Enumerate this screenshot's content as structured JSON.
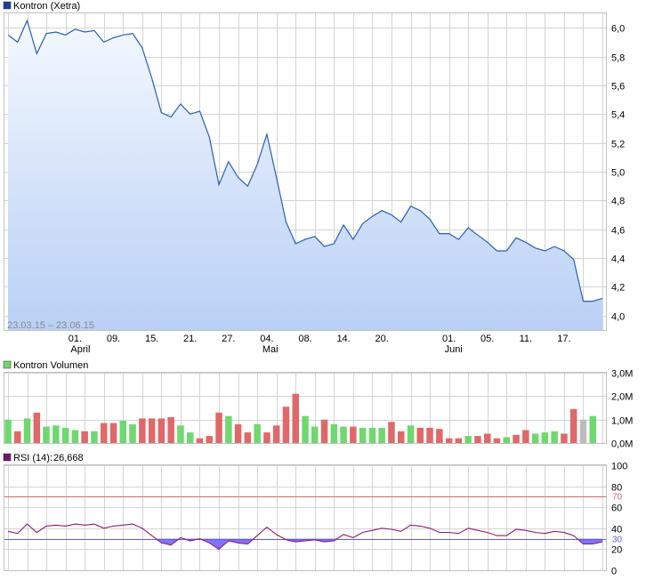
{
  "colors": {
    "price_line": "#2a5fb0",
    "price_fill_top": "#f4f8fe",
    "price_fill_bottom": "#b9d0f5",
    "vol_up": "#6fd86f",
    "vol_down": "#e06868",
    "vol_neutral": "#bdbdbd",
    "rsi_line": "#8c1a7a",
    "rsi_fill": "#6a5cf5",
    "rsi_70": "#d06a6a",
    "rsi_30": "#5a5ae0",
    "legend_price": "#1f3f9a",
    "legend_volume": "#6fd86f",
    "legend_rsi": "#6a1a6a"
  },
  "chart_data": [
    {
      "type": "area",
      "title": "Kontron (Xetra)",
      "date_range": "23.03.15 – 23.06.15",
      "ylim": [
        3.9,
        6.1
      ],
      "y_ticks": [
        "6,0",
        "5,8",
        "5,6",
        "5,4",
        "5,2",
        "5,0",
        "4,8",
        "4,6",
        "4,4",
        "4,2",
        "4,0"
      ],
      "y_tick_values": [
        6.0,
        5.8,
        5.6,
        5.4,
        5.2,
        5.0,
        4.8,
        4.6,
        4.4,
        4.2,
        4.0
      ],
      "x_ticks": [
        {
          "label": "01.",
          "sub": "April",
          "i": 7
        },
        {
          "label": "09.",
          "sub": "",
          "i": 11
        },
        {
          "label": "15.",
          "sub": "",
          "i": 15
        },
        {
          "label": "21.",
          "sub": "",
          "i": 19
        },
        {
          "label": "27.",
          "sub": "",
          "i": 23
        },
        {
          "label": "04.",
          "sub": "Mai",
          "i": 27
        },
        {
          "label": "08.",
          "sub": "",
          "i": 31
        },
        {
          "label": "14.",
          "sub": "",
          "i": 35
        },
        {
          "label": "20.",
          "sub": "",
          "i": 39
        },
        {
          "label": "01.",
          "sub": "Juni",
          "i": 46
        },
        {
          "label": "05.",
          "sub": "",
          "i": 50
        },
        {
          "label": "11.",
          "sub": "",
          "i": 54
        },
        {
          "label": "17.",
          "sub": "",
          "i": 58
        }
      ],
      "values": [
        5.95,
        5.9,
        6.05,
        5.82,
        5.96,
        5.97,
        5.95,
        5.99,
        5.97,
        5.98,
        5.9,
        5.93,
        5.95,
        5.96,
        5.86,
        5.65,
        5.41,
        5.38,
        5.47,
        5.4,
        5.42,
        5.24,
        4.91,
        5.07,
        4.96,
        4.9,
        5.05,
        5.26,
        4.96,
        4.65,
        4.5,
        4.53,
        4.55,
        4.48,
        4.5,
        4.63,
        4.53,
        4.64,
        4.69,
        4.73,
        4.7,
        4.65,
        4.76,
        4.73,
        4.67,
        4.57,
        4.57,
        4.53,
        4.61,
        4.56,
        4.51,
        4.45,
        4.45,
        4.54,
        4.51,
        4.47,
        4.45,
        4.48,
        4.45,
        4.39,
        4.1,
        4.1,
        4.12
      ]
    },
    {
      "type": "bar",
      "title": "Kontron Volumen",
      "ylim": [
        0,
        3.0
      ],
      "y_ticks": [
        "3,0M",
        "2,0M",
        "1,0M",
        "0,0M"
      ],
      "y_tick_values": [
        3.0,
        2.0,
        1.0,
        0.0
      ],
      "values": [
        1.0,
        0.5,
        1.05,
        1.3,
        0.7,
        0.75,
        0.65,
        0.55,
        0.5,
        0.5,
        0.85,
        0.85,
        0.95,
        0.8,
        1.05,
        1.05,
        1.05,
        1.1,
        0.75,
        0.45,
        0.2,
        0.3,
        1.3,
        1.15,
        0.8,
        0.45,
        0.8,
        0.45,
        0.75,
        1.55,
        2.1,
        1.15,
        0.7,
        1.0,
        0.8,
        0.7,
        0.7,
        0.65,
        0.65,
        0.65,
        0.9,
        0.5,
        0.75,
        0.65,
        0.65,
        0.6,
        0.2,
        0.2,
        0.3,
        0.3,
        0.4,
        0.2,
        0.25,
        0.35,
        0.55,
        0.4,
        0.45,
        0.5,
        0.4,
        1.45,
        1.0,
        1.15
      ],
      "direction": [
        "u",
        "d",
        "u",
        "d",
        "u",
        "u",
        "u",
        "u",
        "d",
        "u",
        "d",
        "d",
        "u",
        "u",
        "d",
        "d",
        "d",
        "d",
        "u",
        "u",
        "d",
        "d",
        "d",
        "u",
        "d",
        "d",
        "u",
        "d",
        "d",
        "d",
        "d",
        "u",
        "u",
        "d",
        "u",
        "u",
        "d",
        "u",
        "u",
        "u",
        "d",
        "d",
        "u",
        "d",
        "d",
        "d",
        "d",
        "d",
        "u",
        "d",
        "d",
        "d",
        "u",
        "d",
        "d",
        "u",
        "u",
        "u",
        "d",
        "d",
        "n",
        "u"
      ]
    },
    {
      "type": "line",
      "title": "RSI (14):",
      "value_label": "26,668",
      "ylim": [
        0,
        100
      ],
      "y_ticks": [
        "100",
        "80",
        "60",
        "40",
        "20",
        "0"
      ],
      "y_tick_values": [
        100,
        80,
        60,
        40,
        20,
        0
      ],
      "levels": [
        {
          "label": "70",
          "value": 70
        },
        {
          "label": "30",
          "value": 30
        }
      ],
      "values": [
        37,
        35,
        44,
        36,
        42,
        43,
        42,
        44,
        43,
        44,
        40,
        42,
        43,
        44,
        40,
        33,
        26,
        24,
        31,
        28,
        30,
        26,
        20,
        28,
        26,
        25,
        33,
        41,
        34,
        29,
        27,
        28,
        29,
        27,
        28,
        34,
        31,
        36,
        38,
        40,
        39,
        37,
        43,
        42,
        40,
        36,
        36,
        35,
        40,
        38,
        36,
        33,
        33,
        39,
        38,
        36,
        35,
        37,
        36,
        33,
        25,
        25,
        27
      ]
    }
  ]
}
